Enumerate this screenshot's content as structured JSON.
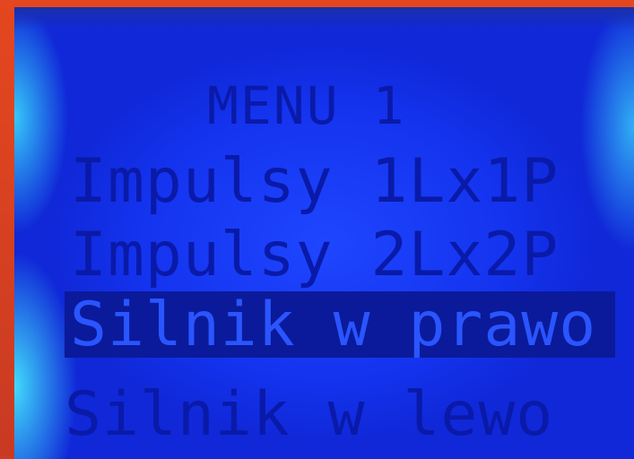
{
  "menu": {
    "title": "MENU 1",
    "items": [
      {
        "label": "Impulsy 1Lx1P",
        "selected": false
      },
      {
        "label": "Impulsy 2Lx2P",
        "selected": false
      },
      {
        "label": "Silnik w prawo",
        "selected": true
      },
      {
        "label": "Silnik w lewo",
        "selected": false
      }
    ]
  },
  "colors": {
    "frame": "#d4381f",
    "backlight": "#1f46ff",
    "pixel": "#0a1aa8",
    "highlight": "#0a1a9a"
  }
}
